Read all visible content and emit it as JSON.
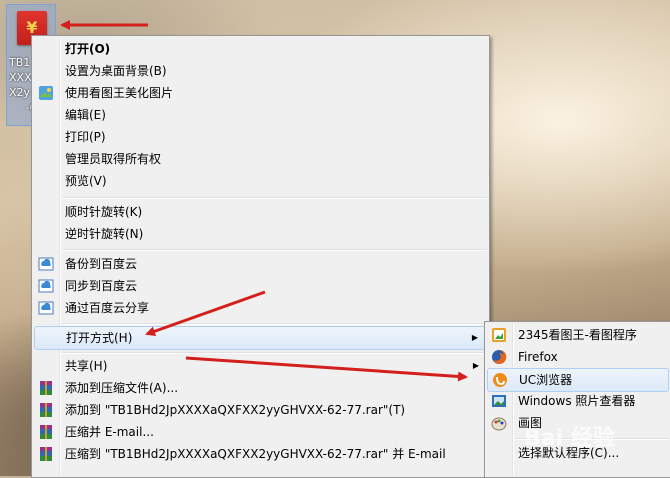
{
  "desktop_icon": {
    "caption_lines": [
      "TB1",
      "XXX",
      "X2y",
      "-6"
    ]
  },
  "main_menu": {
    "items": [
      {
        "label": "打开(O)",
        "bold": true
      },
      {
        "label": "设置为桌面背景(B)"
      },
      {
        "label": "使用看图王美化图片",
        "icon": "picture-king-icon"
      },
      {
        "label": "编辑(E)"
      },
      {
        "label": "打印(P)"
      },
      {
        "label": "管理员取得所有权"
      },
      {
        "label": "预览(V)"
      },
      {
        "label": "顺时针旋转(K)"
      },
      {
        "label": "逆时针旋转(N)"
      },
      {
        "label": "备份到百度云",
        "icon": "baidu-cloud-icon"
      },
      {
        "label": "同步到百度云",
        "icon": "baidu-cloud-icon"
      },
      {
        "label": "通过百度云分享",
        "icon": "baidu-cloud-icon"
      },
      {
        "label": "打开方式(H)",
        "submenu": true
      },
      {
        "label": "共享(H)",
        "submenu": true
      },
      {
        "label": "添加到压缩文件(A)...",
        "icon": "winrar-icon"
      },
      {
        "label": "添加到 \"TB1BHd2JpXXXXaQXFXX2yyGHVXX-62-77.rar\"(T)",
        "icon": "winrar-icon"
      },
      {
        "label": "压缩并 E-mail...",
        "icon": "winrar-icon"
      },
      {
        "label": "压缩到 \"TB1BHd2JpXXXXaQXFXX2yyGHVXX-62-77.rar\" 并 E-mail",
        "icon": "winrar-icon"
      }
    ]
  },
  "sub_menu": {
    "items": [
      {
        "label": "2345看图王-看图程序",
        "icon": "2345-viewer-icon"
      },
      {
        "label": "Firefox",
        "icon": "firefox-icon"
      },
      {
        "label": "UC浏览器",
        "icon": "uc-browser-icon"
      },
      {
        "label": "Windows 照片查看器",
        "icon": "photo-viewer-icon"
      },
      {
        "label": "画图",
        "icon": "paint-icon"
      },
      {
        "label": "选择默认程序(C)...",
        "icon": ""
      }
    ]
  },
  "watermark": "Bai 经验",
  "colors": {
    "arrow": "#d3201c",
    "highlight": "#dce9f8"
  }
}
